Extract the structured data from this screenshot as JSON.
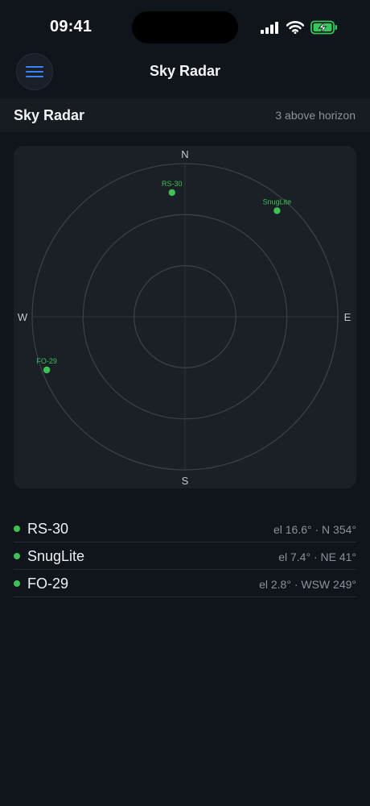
{
  "status_bar": {
    "time": "09:41",
    "signal_icon": "cellular-signal-icon",
    "wifi_icon": "wifi-icon",
    "battery_icon": "battery-charging-icon",
    "battery_color": "#34c759"
  },
  "nav": {
    "menu_icon": "hamburger-menu-icon",
    "title": "Sky Radar",
    "accent": "#3b82f6"
  },
  "section": {
    "title": "Sky Radar",
    "count_label": "3 above horizon"
  },
  "radar": {
    "cardinals": {
      "n": "N",
      "e": "E",
      "s": "S",
      "w": "W"
    },
    "max_elevation_deg": 90,
    "satellites": [
      {
        "name": "RS-30",
        "elevation": 16.6,
        "azimuth": 354
      },
      {
        "name": "SnugLite",
        "elevation": 7.4,
        "azimuth": 41
      },
      {
        "name": "FO-29",
        "elevation": 2.8,
        "azimuth": 249
      }
    ],
    "dot_color": "#3cc255"
  },
  "list": [
    {
      "name": "RS-30",
      "detail": "el 16.6° · N 354°"
    },
    {
      "name": "SnugLite",
      "detail": "el 7.4° · NE 41°"
    },
    {
      "name": "FO-29",
      "detail": "el 2.8° · WSW 249°"
    }
  ]
}
